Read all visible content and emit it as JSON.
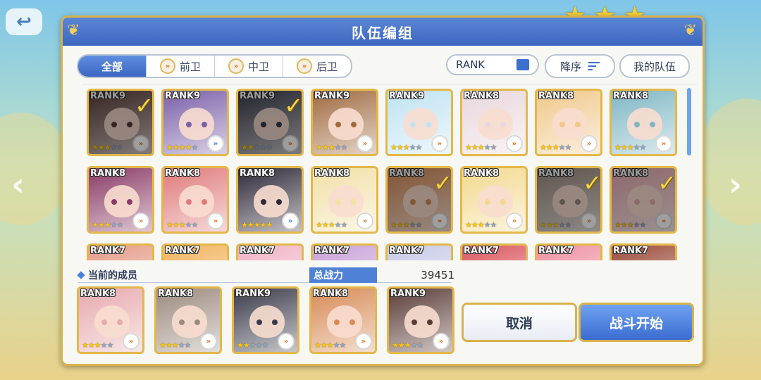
{
  "dialog": {
    "title": "队伍编组",
    "filters": [
      {
        "label": "全部",
        "active": true
      },
      {
        "label": "前卫",
        "active": false
      },
      {
        "label": "中卫",
        "active": false
      },
      {
        "label": "后卫",
        "active": false
      }
    ],
    "sort_key_label": "RANK",
    "order_label": "降序",
    "my_team_label": "我的队伍"
  },
  "roster": [
    {
      "rank": "RANK9",
      "stars": 3,
      "selected": true,
      "color": "#5a3b36"
    },
    {
      "rank": "RANK9",
      "stars": 4,
      "selected": false,
      "color": "#7a5fa8"
    },
    {
      "rank": "RANK9",
      "stars": 2,
      "selected": true,
      "color": "#3a3a4a"
    },
    {
      "rank": "RANK9",
      "stars": 3,
      "selected": false,
      "color": "#a06a40"
    },
    {
      "rank": "RANK9",
      "stars": 3,
      "selected": false,
      "color": "#bfe3f2"
    },
    {
      "rank": "RANK8",
      "stars": 3,
      "selected": false,
      "color": "#e9d7de"
    },
    {
      "rank": "RANK8",
      "stars": 3,
      "selected": false,
      "color": "#f0c88a"
    },
    {
      "rank": "RANK8",
      "stars": 3,
      "selected": false,
      "color": "#7fb6c4"
    },
    {
      "rank": "RANK8",
      "stars": 3,
      "selected": false,
      "color": "#8a3a66"
    },
    {
      "rank": "RANK8",
      "stars": 3,
      "selected": false,
      "color": "#e07a7a"
    },
    {
      "rank": "RANK8",
      "stars": 5,
      "selected": false,
      "color": "#2e2838"
    },
    {
      "rank": "RANK8",
      "stars": 3,
      "selected": false,
      "color": "#f2e0a6"
    },
    {
      "rank": "RANK8",
      "stars": 3,
      "selected": true,
      "color": "#d78a55"
    },
    {
      "rank": "RANK8",
      "stars": 3,
      "selected": false,
      "color": "#f3d98e"
    },
    {
      "rank": "RANK8",
      "stars": 3,
      "selected": true,
      "color": "#9c8a7e"
    },
    {
      "rank": "RANK8",
      "stars": 3,
      "selected": true,
      "color": "#e7a9ae"
    },
    {
      "rank": "RANK7",
      "stars": 0,
      "selected": false,
      "color": "#e59a86"
    },
    {
      "rank": "RANK7",
      "stars": 0,
      "selected": false,
      "color": "#f2b25c"
    },
    {
      "rank": "RANK7",
      "stars": 0,
      "selected": false,
      "color": "#f1b2c4"
    },
    {
      "rank": "RANK7",
      "stars": 0,
      "selected": false,
      "color": "#c7a0d8"
    },
    {
      "rank": "RANK7",
      "stars": 0,
      "selected": false,
      "color": "#c7c9e8"
    },
    {
      "rank": "RANK7",
      "stars": 0,
      "selected": false,
      "color": "#d9565e"
    },
    {
      "rank": "RANK7",
      "stars": 0,
      "selected": false,
      "color": "#ee8fa0"
    },
    {
      "rank": "RANK7",
      "stars": 0,
      "selected": false,
      "color": "#9a4a38"
    }
  ],
  "current_members_label": "当前的成员",
  "total_power_label": "总战力",
  "total_power_value": "39451",
  "members": [
    {
      "rank": "RANK8",
      "stars": 3,
      "color": "#e7a9ae"
    },
    {
      "rank": "RANK8",
      "stars": 3,
      "color": "#9c8a7e"
    },
    {
      "rank": "RANK9",
      "stars": 2,
      "color": "#3a3a4a"
    },
    {
      "rank": "RANK8",
      "stars": 3,
      "color": "#d78a55"
    },
    {
      "rank": "RANK9",
      "stars": 3,
      "color": "#5a3b36"
    }
  ],
  "buttons": {
    "cancel": "取消",
    "start": "战斗开始"
  }
}
